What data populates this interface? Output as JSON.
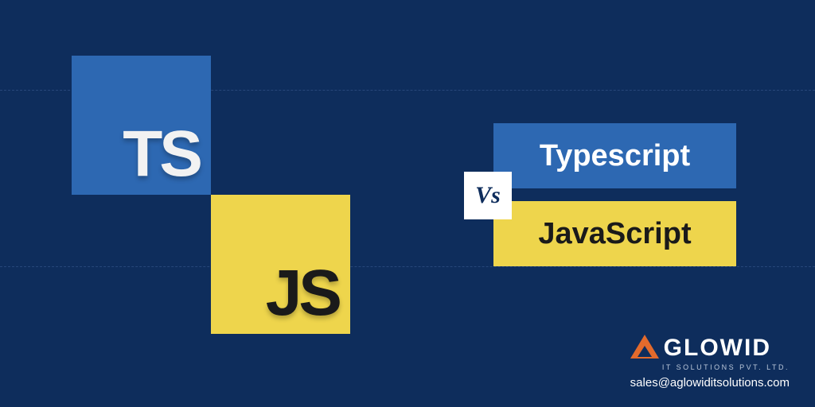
{
  "logos": {
    "ts": "TS",
    "js": "JS"
  },
  "labels": {
    "typescript": "Typescript",
    "javascript": "JavaScript",
    "vs": "Vs"
  },
  "brand": {
    "name": "GLOWID",
    "tagline": "IT SOLUTIONS PVT. LTD.",
    "email": "sales@aglowiditsolutions.com"
  },
  "colors": {
    "bg": "#0e2d5c",
    "ts_blue": "#2d68b2",
    "js_yellow": "#eed54c",
    "orange": "#e26a2c"
  }
}
